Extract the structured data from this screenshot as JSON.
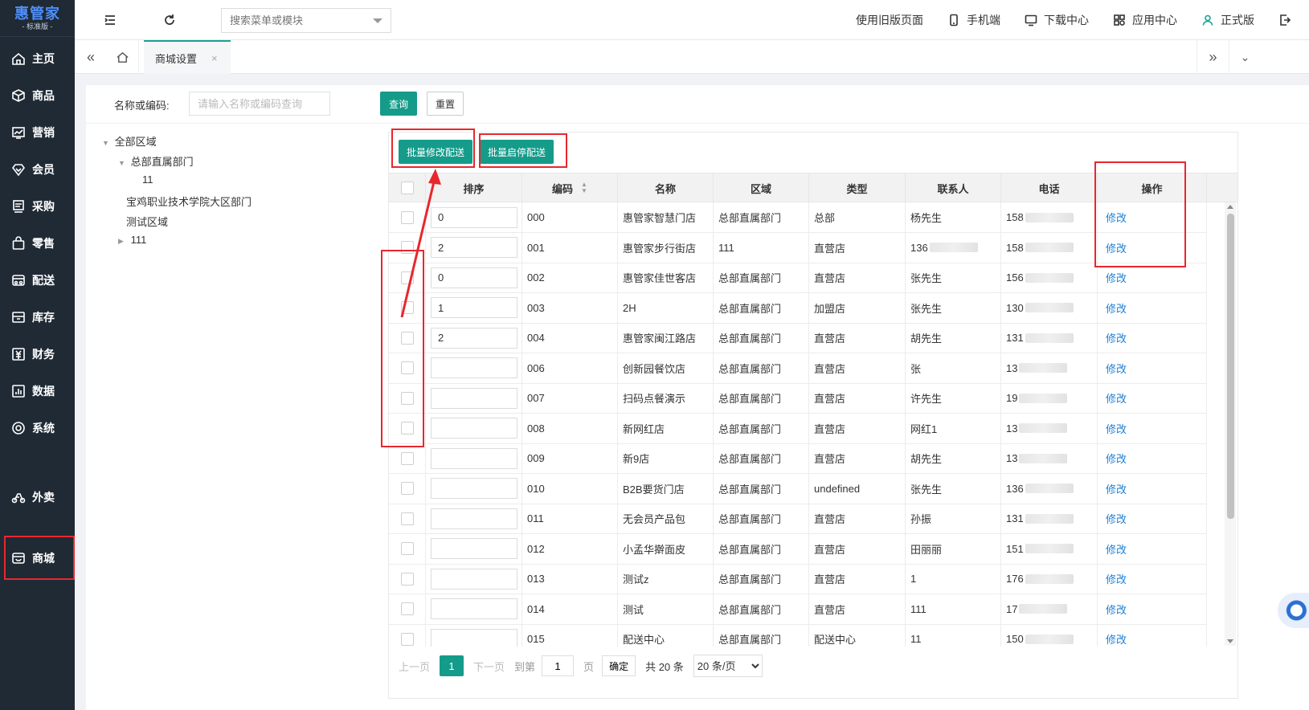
{
  "app": {
    "brand": "惠管家",
    "edition": "- 标准版 -"
  },
  "sidebar": {
    "items": [
      {
        "label": "主页",
        "icon": "home-icon"
      },
      {
        "label": "商品",
        "icon": "box-icon"
      },
      {
        "label": "营销",
        "icon": "chart-icon"
      },
      {
        "label": "会员",
        "icon": "diamond-icon"
      },
      {
        "label": "采购",
        "icon": "purchase-icon"
      },
      {
        "label": "零售",
        "icon": "bag-icon"
      },
      {
        "label": "配送",
        "icon": "delivery-icon"
      },
      {
        "label": "库存",
        "icon": "inventory-icon"
      },
      {
        "label": "财务",
        "icon": "finance-icon"
      },
      {
        "label": "数据",
        "icon": "data-icon"
      },
      {
        "label": "系统",
        "icon": "system-icon"
      },
      {
        "label": "外卖",
        "icon": "takeout-icon"
      },
      {
        "label": "商城",
        "icon": "mall-icon"
      }
    ],
    "active": "商城"
  },
  "topbar": {
    "search_placeholder": "搜索菜单或模块",
    "links": [
      {
        "label": "使用旧版页面",
        "icon": ""
      },
      {
        "label": "手机端",
        "icon": "mobile-icon"
      },
      {
        "label": "下载中心",
        "icon": "download-icon"
      },
      {
        "label": "应用中心",
        "icon": "apps-icon"
      },
      {
        "label": "正式版",
        "icon": "user-icon"
      }
    ]
  },
  "tabs": {
    "active_tab": "商城设置",
    "close": "×"
  },
  "filter": {
    "label": "名称或编码:",
    "placeholder": "请输入名称或编码查询",
    "query_button": "查询",
    "reset_button": "重置"
  },
  "tree": {
    "root": "全部区域",
    "child1": "总部直属部门",
    "grandchild": "11",
    "child2": "宝鸡职业技术学院大区部门",
    "child3": "测试区域",
    "child4": "111"
  },
  "batch": {
    "modify": "批量修改配送",
    "toggle": "批量启停配送"
  },
  "table": {
    "headers": {
      "sort": "排序",
      "code": "编码",
      "name": "名称",
      "region": "区域",
      "type": "类型",
      "contact": "联系人",
      "phone": "电话",
      "action": "操作"
    },
    "rows": [
      {
        "sort": "0",
        "code": "000",
        "name": "惠管家智慧门店",
        "region": "总部直属部门",
        "type": "总部",
        "contact": "杨先生",
        "phone": "158",
        "action": "修改"
      },
      {
        "sort": "2",
        "code": "001",
        "name": "惠管家步行街店",
        "region": "111",
        "type": "直营店",
        "contact": "136",
        "phone": "158",
        "action": "修改"
      },
      {
        "sort": "0",
        "code": "002",
        "name": "惠管家佳世客店",
        "region": "总部直属部门",
        "type": "直营店",
        "contact": "张先生",
        "phone": "156",
        "action": "修改"
      },
      {
        "sort": "1",
        "code": "003",
        "name": "2H",
        "region": "总部直属部门",
        "type": "加盟店",
        "contact": "张先生",
        "phone": "130",
        "action": "修改"
      },
      {
        "sort": "2",
        "code": "004",
        "name": "惠管家闽江路店",
        "region": "总部直属部门",
        "type": "直营店",
        "contact": "胡先生",
        "phone": "131",
        "action": "修改"
      },
      {
        "sort": "",
        "code": "006",
        "name": "创新园餐饮店",
        "region": "总部直属部门",
        "type": "直营店",
        "contact": "张",
        "phone": "13",
        "action": "修改"
      },
      {
        "sort": "",
        "code": "007",
        "name": "扫码点餐演示",
        "region": "总部直属部门",
        "type": "直营店",
        "contact": "许先生",
        "phone": "19",
        "action": "修改"
      },
      {
        "sort": "",
        "code": "008",
        "name": "新网红店",
        "region": "总部直属部门",
        "type": "直营店",
        "contact": "网红1",
        "phone": "13",
        "action": "修改"
      },
      {
        "sort": "",
        "code": "009",
        "name": "新9店",
        "region": "总部直属部门",
        "type": "直营店",
        "contact": "胡先生",
        "phone": "13",
        "action": "修改"
      },
      {
        "sort": "",
        "code": "010",
        "name": "B2B要货门店",
        "region": "总部直属部门",
        "type": "undefined",
        "contact": "张先生",
        "phone": "136",
        "action": "修改"
      },
      {
        "sort": "",
        "code": "011",
        "name": "无会员产品包",
        "region": "总部直属部门",
        "type": "直营店",
        "contact": "孙振",
        "phone": "131",
        "action": "修改"
      },
      {
        "sort": "",
        "code": "012",
        "name": "小孟华擀面皮",
        "region": "总部直属部门",
        "type": "直营店",
        "contact": "田丽丽",
        "phone": "151",
        "action": "修改"
      },
      {
        "sort": "",
        "code": "013",
        "name": "测试z",
        "region": "总部直属部门",
        "type": "直营店",
        "contact": "1",
        "phone": "176",
        "action": "修改"
      },
      {
        "sort": "",
        "code": "014",
        "name": "测试",
        "region": "总部直属部门",
        "type": "直营店",
        "contact": "111",
        "phone": "17",
        "action": "修改"
      },
      {
        "sort": "",
        "code": "015",
        "name": "配送中心",
        "region": "总部直属部门",
        "type": "配送中心",
        "contact": "11",
        "phone": "150",
        "action": "修改"
      }
    ]
  },
  "pager": {
    "prev": "上一页",
    "current": "1",
    "next": "下一页",
    "goto_label": "到第",
    "goto_value": "1",
    "page_label": "页",
    "confirm": "确定",
    "total": "共 20 条",
    "page_size": "20 条/页"
  },
  "colors": {
    "sidebar_bg": "#1f2a35",
    "primary": "#159b8a",
    "link": "#1e7fd6",
    "annotation": "#e8272d"
  }
}
